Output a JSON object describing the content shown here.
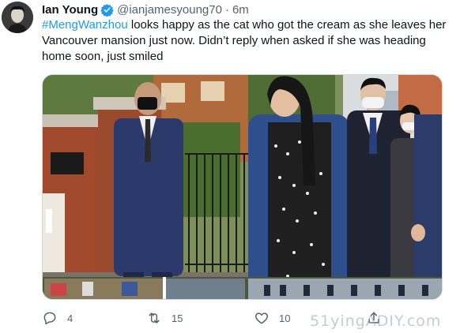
{
  "author": {
    "name": "Ian Young",
    "handle": "@ianjamesyoung70",
    "separator": "·",
    "time": "6m"
  },
  "tweet": {
    "hashtag": "#MengWanzhou",
    "text": " looks happy as the cat who got the cream as she leaves her Vancouver mansion just now. Didn’t reply when asked if she was heading home soon, just smiled"
  },
  "actions": {
    "replies": "4",
    "retweets": "15",
    "likes": "10"
  },
  "watermark": "51yingADIY.com",
  "colors": {
    "link": "#1d9bf0",
    "verified": "#1d9bf0",
    "muted": "#536471"
  },
  "icons": {
    "reply": "speech-bubble-outline",
    "retweet": "retweet-arrows",
    "like": "heart-outline",
    "share": "upload-arrow"
  }
}
